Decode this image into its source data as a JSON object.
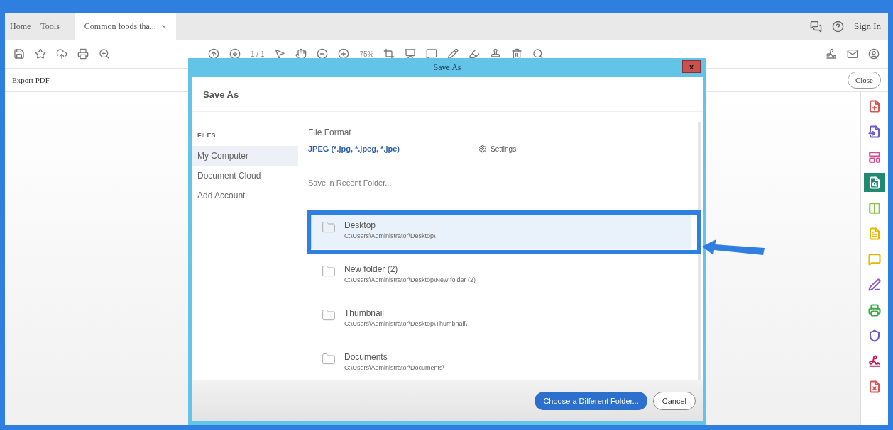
{
  "tabs": [
    {
      "label": "Home",
      "selected": false
    },
    {
      "label": "Tools",
      "selected": false
    },
    {
      "label": "Common foods tha...",
      "close": "×",
      "selected": true
    }
  ],
  "sign_in": "Sign In",
  "toolbar": {
    "page": "1 / 1",
    "zoom": "75%"
  },
  "export_bar": {
    "title": "Export PDF",
    "close": "Close"
  },
  "tools": [
    {
      "color": "#d9534f",
      "selected": false
    },
    {
      "color": "#6a5acd",
      "selected": false
    },
    {
      "color": "#d9478f",
      "selected": false
    },
    {
      "color": "#1f8a70",
      "selected": true
    },
    {
      "color": "#8bc34a",
      "selected": false
    },
    {
      "color": "#e6b800",
      "selected": false
    },
    {
      "color": "#e6b800",
      "selected": false
    },
    {
      "color": "#8e5cc5",
      "selected": false
    },
    {
      "color": "#3ea84a",
      "selected": false
    },
    {
      "color": "#6a5acd",
      "selected": false
    },
    {
      "color": "#c2185b",
      "selected": false
    },
    {
      "color": "#d9534f",
      "selected": false
    }
  ],
  "dialog": {
    "title": "Save As",
    "close": "x",
    "heading": "Save As",
    "sidebar": {
      "section": "FILES",
      "items": [
        {
          "label": "My Computer",
          "selected": true
        },
        {
          "label": "Document Cloud",
          "selected": false
        },
        {
          "label": "Add Account",
          "selected": false
        }
      ]
    },
    "file_format_label": "File Format",
    "file_format": "JPEG (*.jpg, *.jpeg, *.jpe)",
    "settings": "Settings",
    "recent_label": "Save in Recent Folder...",
    "folders": [
      {
        "name": "Desktop",
        "path": "C:\\Users\\Administrator\\Desktop\\",
        "selected": true
      },
      {
        "name": "New folder (2)",
        "path": "C:\\Users\\Administrator\\Desktop\\New folder (2)",
        "selected": false
      },
      {
        "name": "Thumbnail",
        "path": "C:\\Users\\Administrator\\Desktop\\Thumbnail\\",
        "selected": false
      },
      {
        "name": "Documents",
        "path": "C:\\Users\\Administrator\\Documents\\",
        "selected": false
      }
    ],
    "buttons": {
      "primary": "Choose a Different Folder...",
      "cancel": "Cancel"
    }
  }
}
